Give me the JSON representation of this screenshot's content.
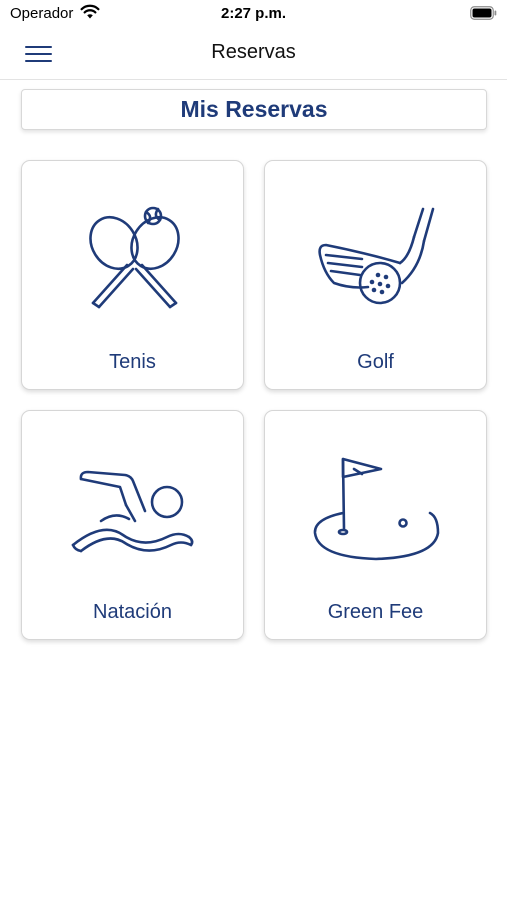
{
  "status_bar": {
    "carrier": "Operador",
    "time": "2:27 p.m.",
    "wifi_icon": "wifi-icon",
    "battery_icon": "battery-icon"
  },
  "nav": {
    "title": "Reservas",
    "menu_icon": "hamburger-menu-icon"
  },
  "mis_reservas": {
    "label": "Mis Reservas"
  },
  "tiles": [
    {
      "label": "Tenis",
      "icon": "tennis-rackets-icon"
    },
    {
      "label": "Golf",
      "icon": "golf-club-ball-icon"
    },
    {
      "label": "Natación",
      "icon": "swimmer-icon"
    },
    {
      "label": "Green Fee",
      "icon": "golf-flag-hole-icon"
    }
  ],
  "colors": {
    "accent": "#1f3b79",
    "background": "#ffffff",
    "card_border": "#d6d6d6"
  }
}
